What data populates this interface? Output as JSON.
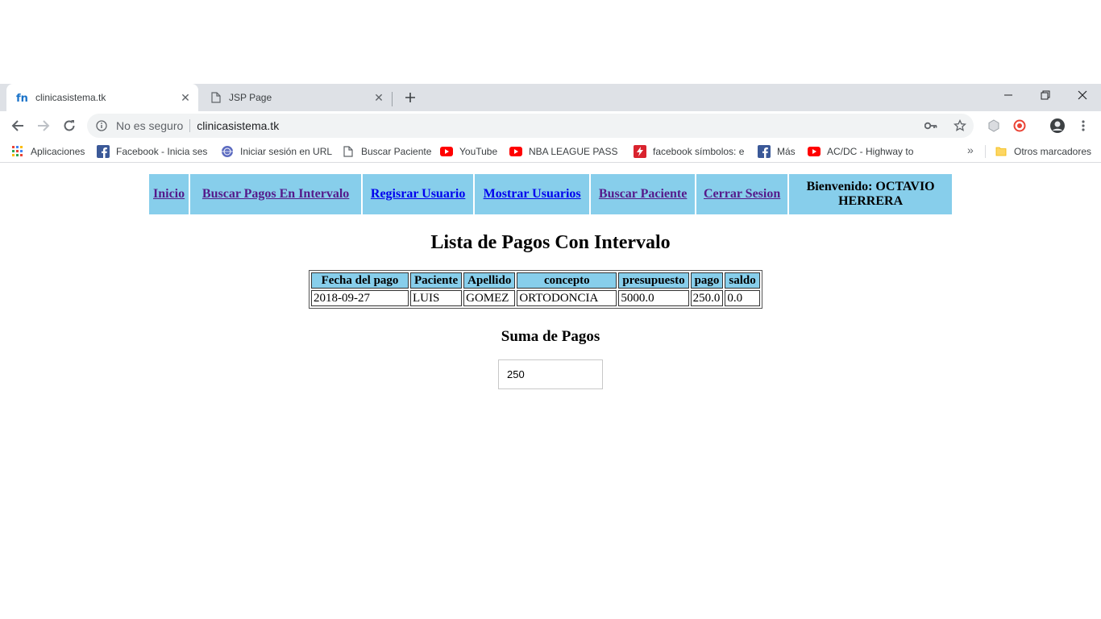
{
  "browser": {
    "tabs": [
      {
        "title": "clinicasistema.tk",
        "active": true
      },
      {
        "title": "JSP Page",
        "active": false
      }
    ],
    "security_label": "No es seguro",
    "url": "clinicasistema.tk",
    "bookmarks": [
      {
        "label": "Aplicaciones",
        "icon": "apps-grid-icon"
      },
      {
        "label": "Facebook - Inicia sesi",
        "icon": "facebook-icon"
      },
      {
        "label": "Iniciar sesión en URL",
        "icon": "globe-icon"
      },
      {
        "label": "Buscar Paciente",
        "icon": "page-icon"
      },
      {
        "label": "YouTube",
        "icon": "youtube-icon"
      },
      {
        "label": "NBA LEAGUE PASS H",
        "icon": "youtube-icon"
      },
      {
        "label": "facebook símbolos: e",
        "icon": "flash-icon"
      },
      {
        "label": "Más",
        "icon": "facebook-icon"
      },
      {
        "label": "AC/DC - Highway to",
        "icon": "youtube-icon"
      },
      {
        "label": "Otros marcadores",
        "icon": "folder-icon"
      }
    ]
  },
  "nav": {
    "items": [
      {
        "label": "Inicio"
      },
      {
        "label": "Buscar Pagos En Intervalo"
      },
      {
        "label": "Regisrar Usuario"
      },
      {
        "label": "Mostrar Usuarios"
      },
      {
        "label": "Buscar Paciente"
      },
      {
        "label": "Cerrar Sesion"
      }
    ],
    "welcome_line1": "Bienvenido: OCTAVIO",
    "welcome_line2": "HERRERA"
  },
  "main": {
    "title": "Lista de Pagos Con Intervalo",
    "table": {
      "headers": [
        "Fecha del pago",
        "Paciente",
        "Apellido",
        "concepto",
        "presupuesto",
        "pago",
        "saldo"
      ],
      "rows": [
        [
          "2018-09-27",
          "LUIS",
          "GOMEZ",
          "ORTODONCIA",
          "5000.0",
          "250.0",
          "0.0"
        ]
      ]
    },
    "sum_title": "Suma de Pagos",
    "sum_value": "250"
  },
  "colors": {
    "header_bg": "#87ceeb",
    "link": "#0000ee",
    "visited_link": "#551a8b"
  }
}
